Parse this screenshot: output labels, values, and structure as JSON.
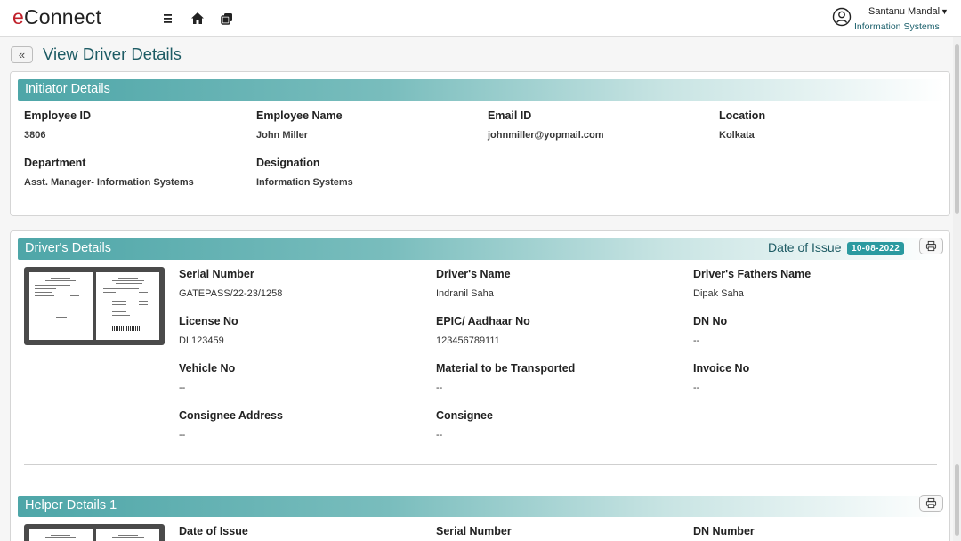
{
  "app": {
    "logo_e": "e",
    "logo_rest": "Connect"
  },
  "header": {
    "user_name": "Santanu Mandal",
    "user_dept": "Information Systems",
    "icons": [
      "menu-icon",
      "home-icon",
      "copy-icon",
      "user-circle-icon"
    ]
  },
  "page": {
    "back_label": "«",
    "title": "View Driver Details"
  },
  "initiator": {
    "title": "Initiator Details",
    "fields": [
      {
        "label": "Employee ID",
        "value": "3806"
      },
      {
        "label": "Employee Name",
        "value": "John Miller"
      },
      {
        "label": "Email ID",
        "value": "johnmiller@yopmail.com"
      },
      {
        "label": "Location",
        "value": "Kolkata"
      },
      {
        "label": "Department",
        "value": "Asst. Manager- Information Systems"
      },
      {
        "label": "Designation",
        "value": "Information Systems"
      }
    ]
  },
  "driver": {
    "title": "Driver's Details",
    "issue_label": "Date of Issue",
    "issue_date": "10-08-2022",
    "fields": [
      {
        "label": "Serial Number",
        "value": "GATEPASS/22-23/1258"
      },
      {
        "label": "Driver's Name",
        "value": "Indranil Saha"
      },
      {
        "label": "Driver's Fathers Name",
        "value": "Dipak Saha"
      },
      {
        "label": "License No",
        "value": "DL123459"
      },
      {
        "label": "EPIC/ Aadhaar No",
        "value": "123456789111"
      },
      {
        "label": "DN No",
        "value": "--"
      },
      {
        "label": "Vehicle No",
        "value": "--"
      },
      {
        "label": "Material to be Transported",
        "value": "--"
      },
      {
        "label": "Invoice No",
        "value": "--"
      },
      {
        "label": "Consignee Address",
        "value": "--"
      },
      {
        "label": "Consignee",
        "value": "--"
      }
    ]
  },
  "helper": {
    "title": "Helper Details 1",
    "fields": [
      {
        "label": "Date of Issue"
      },
      {
        "label": "Serial Number"
      },
      {
        "label": "DN Number"
      }
    ]
  },
  "colors": {
    "brand_red": "#c0202a",
    "teal_title": "#1d5b64",
    "band_start": "#4ea6a8",
    "badge": "#2b9aa0"
  }
}
